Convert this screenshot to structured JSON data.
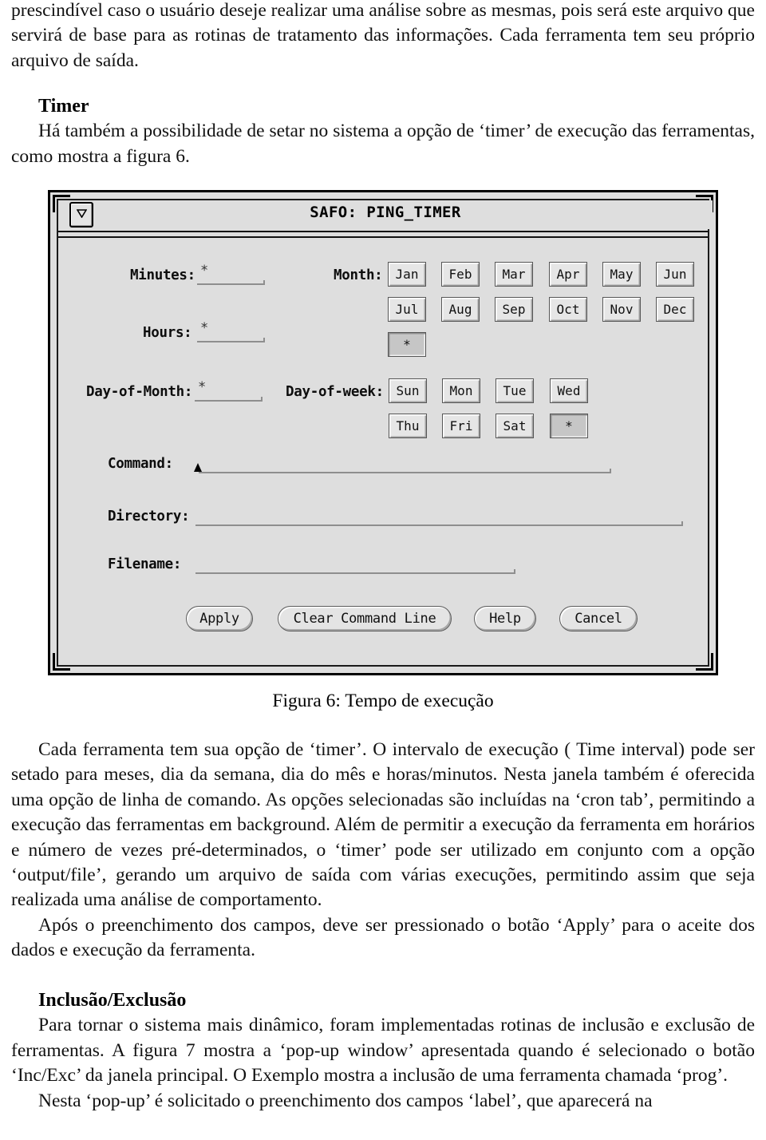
{
  "document": {
    "paragraphs_top": [
      "prescindível caso o usuário deseje realizar uma análise sobre as mesmas, pois será este arquivo que servirá de base para as rotinas de tratamento das informações. Cada ferramenta tem seu próprio arquivo de saída."
    ],
    "timer_heading": "Timer",
    "timer_paragraph": "Há também a possibilidade de setar no sistema a opção de ‘timer’ de execução das ferramentas, como mostra a figura 6.",
    "figure_caption": "Figura 6: Tempo de execução",
    "paragraph_after_figure_1": "Cada ferramenta tem sua opção de ‘timer’. O intervalo de execução ( Time interval) pode ser setado para meses, dia da semana, dia do mês e horas/minutos. Nesta janela também é oferecida uma opção de linha de comando. As opções selecionadas são incluídas na ‘cron tab’, permitindo a execução das ferramentas em background. Além de permitir a execução da ferramenta em horários e número de vezes pré-determinados, o ‘timer’ pode ser utilizado em conjunto com a opção ‘output/file’, gerando um arquivo de saída com várias execuções, permitindo assim que seja realizada uma análise de comportamento.",
    "paragraph_after_figure_2": "Após o preenchimento dos campos, deve ser pressionado o botão ‘Apply’ para o aceite dos dados e execução da ferramenta.",
    "inclusion_heading": "Inclusão/Exclusão",
    "inclusion_paragraph_1": "Para tornar o sistema mais dinâmico, foram implementadas rotinas de inclusão e exclusão de ferramentas. A figura 7 mostra a ‘pop-up window’ apresentada quando é selecionado o botão ‘Inc/Exc’ da janela principal. O Exemplo mostra a inclusão de uma ferramenta chamada ‘prog’.",
    "inclusion_paragraph_2": "Nesta ‘pop-up’ é solicitado o preenchimento dos campos ‘label’, que aparecerá na"
  },
  "figure": {
    "window_title": "SAFO: PING_TIMER",
    "menu_button_icon": "triangle-down-icon",
    "fields": [
      {
        "label": "Minutes:",
        "value": "*"
      },
      {
        "label": "Hours:",
        "value": "*"
      },
      {
        "label": "Day-of-Month:",
        "value": "*"
      },
      {
        "label": "Command:",
        "value": ""
      },
      {
        "label": "Directory:",
        "value": ""
      },
      {
        "label": "Filename:",
        "value": ""
      }
    ],
    "month": {
      "label": "Month:",
      "buttons": [
        {
          "label": "Jan",
          "selected": false
        },
        {
          "label": "Feb",
          "selected": false
        },
        {
          "label": "Mar",
          "selected": false
        },
        {
          "label": "Apr",
          "selected": false
        },
        {
          "label": "May",
          "selected": false
        },
        {
          "label": "Jun",
          "selected": false
        },
        {
          "label": "Jul",
          "selected": false
        },
        {
          "label": "Aug",
          "selected": false
        },
        {
          "label": "Sep",
          "selected": false
        },
        {
          "label": "Oct",
          "selected": false
        },
        {
          "label": "Nov",
          "selected": false
        },
        {
          "label": "Dec",
          "selected": false
        },
        {
          "label": "*",
          "selected": true
        }
      ]
    },
    "day_of_week": {
      "label": "Day-of-week:",
      "buttons": [
        {
          "label": "Sun",
          "selected": false
        },
        {
          "label": "Mon",
          "selected": false
        },
        {
          "label": "Tue",
          "selected": false
        },
        {
          "label": "Wed",
          "selected": false
        },
        {
          "label": "Thu",
          "selected": false
        },
        {
          "label": "Fri",
          "selected": false
        },
        {
          "label": "Sat",
          "selected": false
        },
        {
          "label": "*",
          "selected": true
        }
      ]
    },
    "actions": [
      {
        "label": "Apply"
      },
      {
        "label": "Clear Command Line"
      },
      {
        "label": "Help"
      },
      {
        "label": "Cancel"
      }
    ],
    "colors": {
      "window_bg": "#dedede",
      "button_face": "#e6e6e6",
      "button_selected": "#c6c6c6",
      "frame": "#000000",
      "field_underline": "#8e8e8e"
    }
  }
}
